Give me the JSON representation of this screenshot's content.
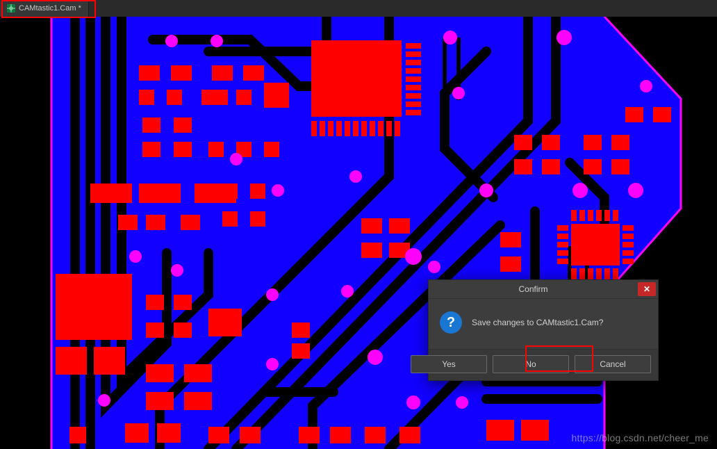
{
  "tab": {
    "label": "CAMtastic1.Cam *"
  },
  "dialog": {
    "title": "Confirm",
    "message": "Save changes to CAMtastic1.Cam?",
    "icon_char": "?",
    "buttons": {
      "yes": "Yes",
      "no": "No",
      "cancel": "Cancel"
    }
  },
  "watermark": "https://blog.csdn.net/cheer_me",
  "colors": {
    "copper": "#1100ff",
    "pad": "#ff0000",
    "via": "#ff00ff",
    "outline": "#ff00ff",
    "trace": "#000000"
  }
}
